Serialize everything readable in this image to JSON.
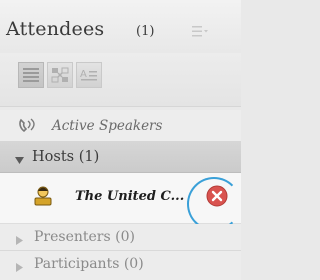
{
  "pod": {
    "title": "Attendees",
    "count": "(1)",
    "menu_icon": "pod-options-menu-icon"
  },
  "toolbar": {
    "buttons": [
      {
        "icon": "list-view-icon",
        "active": true
      },
      {
        "icon": "breakout-view-icon",
        "active": false
      },
      {
        "icon": "sort-icon",
        "active": false
      }
    ]
  },
  "active_speakers": {
    "label": "Active Speakers",
    "icon": "speaker-phone-icon"
  },
  "hosts": {
    "label": "Hosts (1)",
    "expanded": true,
    "users": [
      {
        "name": "The United C...",
        "icon": "host-avatar-icon",
        "action_icon": "remove-icon"
      }
    ]
  },
  "presenters": {
    "label": "Presenters (0)",
    "expanded": false
  },
  "participants": {
    "label": "Participants (0)",
    "expanded": false
  },
  "colors": {
    "accent_ring": "#3aa0d8",
    "remove_red": "#d9534f"
  }
}
